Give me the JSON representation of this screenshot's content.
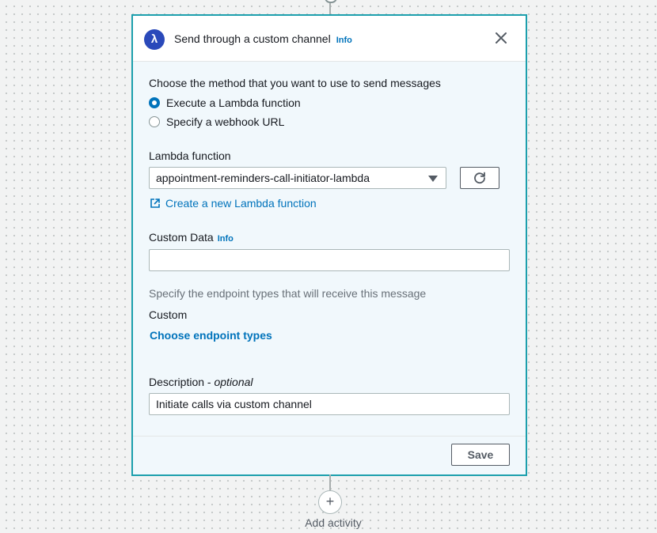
{
  "panel": {
    "title": "Send through a custom channel",
    "info_label": "Info",
    "lambda_icon_glyph": "λ",
    "lambda_icon_name": "lambda-icon",
    "close_icon_name": "close-icon"
  },
  "method": {
    "prompt": "Choose the method that you want to use to send messages",
    "options": [
      {
        "label": "Execute a Lambda function",
        "selected": true
      },
      {
        "label": "Specify a webhook URL",
        "selected": false
      }
    ]
  },
  "lambda": {
    "label": "Lambda function",
    "selected_value": "appointment-reminders-call-initiator-lambda",
    "refresh_icon_name": "refresh-icon",
    "create_link_icon_name": "external-link-icon",
    "create_link": "Create a new Lambda function"
  },
  "custom_data": {
    "label": "Custom Data",
    "info_label": "Info",
    "value": ""
  },
  "endpoints": {
    "hint": "Specify the endpoint types that will receive this message",
    "type": "Custom",
    "choose_link": "Choose endpoint types"
  },
  "description": {
    "label": "Description - ",
    "label_optional": "optional",
    "value": "Initiate calls via custom channel"
  },
  "footer": {
    "save_label": "Save"
  },
  "canvas": {
    "add_icon_glyph": "+",
    "add_activity_label": "Add activity"
  },
  "colors": {
    "accent": "#0073bb",
    "panel_border": "#1c9fad",
    "lambda_badge": "#2a49ba"
  }
}
